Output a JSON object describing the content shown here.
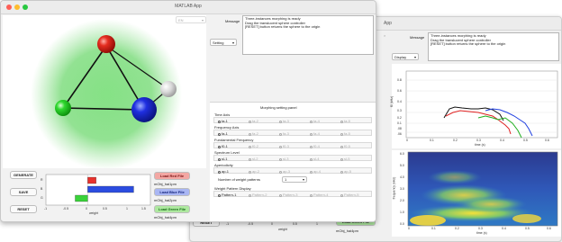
{
  "front_window": {
    "title": "MATLAB App",
    "zoom_value": "EN",
    "message_label": "Message",
    "message_lines": [
      "Three-instances morphing is ready",
      "Drag the translucent sphere controller",
      "[RESET] button returns the sphere to the origin"
    ],
    "mode_dropdown": "Setting",
    "buttons": {
      "generate": "GENERATE",
      "save": "SAVE",
      "reset": "RESET",
      "load_red": "Load Red File",
      "load_blue": "Load Blue File",
      "load_green": "Load Green File"
    },
    "file_labels": {
      "red": "mObj_hai1pm",
      "blue": "mObj_hai2pm",
      "green": "mObj_hai4pm"
    },
    "weight_chart": {
      "y_ticks": [
        "R",
        "B",
        "G"
      ],
      "x_ticks": [
        "-1",
        "-0.5",
        "0",
        "0.5",
        "1",
        "1.5"
      ],
      "xlabel": "weight",
      "bars": [
        {
          "name": "R",
          "color": "#e8322d",
          "value": 0.2
        },
        {
          "name": "B",
          "color": "#2b4ce0",
          "value": 1.1
        },
        {
          "name": "G",
          "color": "#3ad33a",
          "value": -0.3
        }
      ]
    },
    "panel": {
      "title": "Morphing setting panel",
      "time_axis": {
        "label": "Time Axis",
        "options": [
          "ta-1",
          "ta-2",
          "ta-3",
          "ta-4",
          "ta-5"
        ],
        "selected": 0
      },
      "frequency_axis": {
        "label": "Frequency Axis",
        "options": [
          "fa-1",
          "fa-2",
          "fa-3",
          "fa-4",
          "fa-5"
        ],
        "selected": 0
      },
      "fundamental_frequency": {
        "label": "Fundamental Frequency",
        "options": [
          "f0-1",
          "f0-2",
          "f0-3",
          "f0-4",
          "f0-5"
        ],
        "selected": 0
      },
      "spectrum_level": {
        "label": "Spectrum Level",
        "options": [
          "sl-1",
          "sl-2",
          "sl-3",
          "sl-4",
          "sl-5"
        ],
        "selected": 0
      },
      "aperiodicity": {
        "label": "Aperiodicity",
        "options": [
          "ap-1",
          "ap-2",
          "ap-3",
          "ap-4",
          "ap-5"
        ],
        "selected": 0
      },
      "weight_patterns_label": "Number of weight patterns",
      "weight_patterns_value": "1",
      "weight_display": {
        "label": "Weight Pattern Display",
        "options": [
          "Pattern-1",
          "Pattern-2",
          "Pattern-3",
          "Pattern-4",
          "Pattern-5"
        ],
        "selected": 0
      }
    }
  },
  "back_window": {
    "title": "App",
    "message_label": "Message",
    "message_lines": [
      "Three-instances morphing is ready",
      "Drag the translucent sphere controller",
      "[RESET] button returns the sphere to the origin"
    ],
    "mode_dropdown": "Display",
    "reset_label": "RESET",
    "load_green": "Load Green File",
    "green_file": "mObj_hai4pm",
    "xlabel_weight": "weight",
    "weight_ticks": [
      "-1",
      "-0.5",
      "0",
      "0.5",
      "1",
      "1.5"
    ],
    "f0_chart": {
      "ylabel": "f0 (kHz)",
      "xlabel": "time (s)",
      "y_ticks": [
        "0.8",
        "0.6",
        "0.4",
        "0.3",
        "0.2",
        "0.1",
        ".08",
        ".06"
      ],
      "x_ticks": [
        "0",
        "0.1",
        "0.2",
        "0.3",
        "0.4",
        "0.5",
        "0.6"
      ]
    },
    "spec_chart": {
      "ylabel": "frequency (kHz)",
      "xlabel": "time (s)",
      "y_ticks": [
        "6.0",
        "5.0",
        "4.0",
        "3.0",
        "2.0",
        "1.0",
        "0.0"
      ],
      "x_ticks": [
        "0",
        "0.1",
        "0.2",
        "0.3",
        "0.4",
        "0.5",
        "0.6"
      ]
    }
  }
}
